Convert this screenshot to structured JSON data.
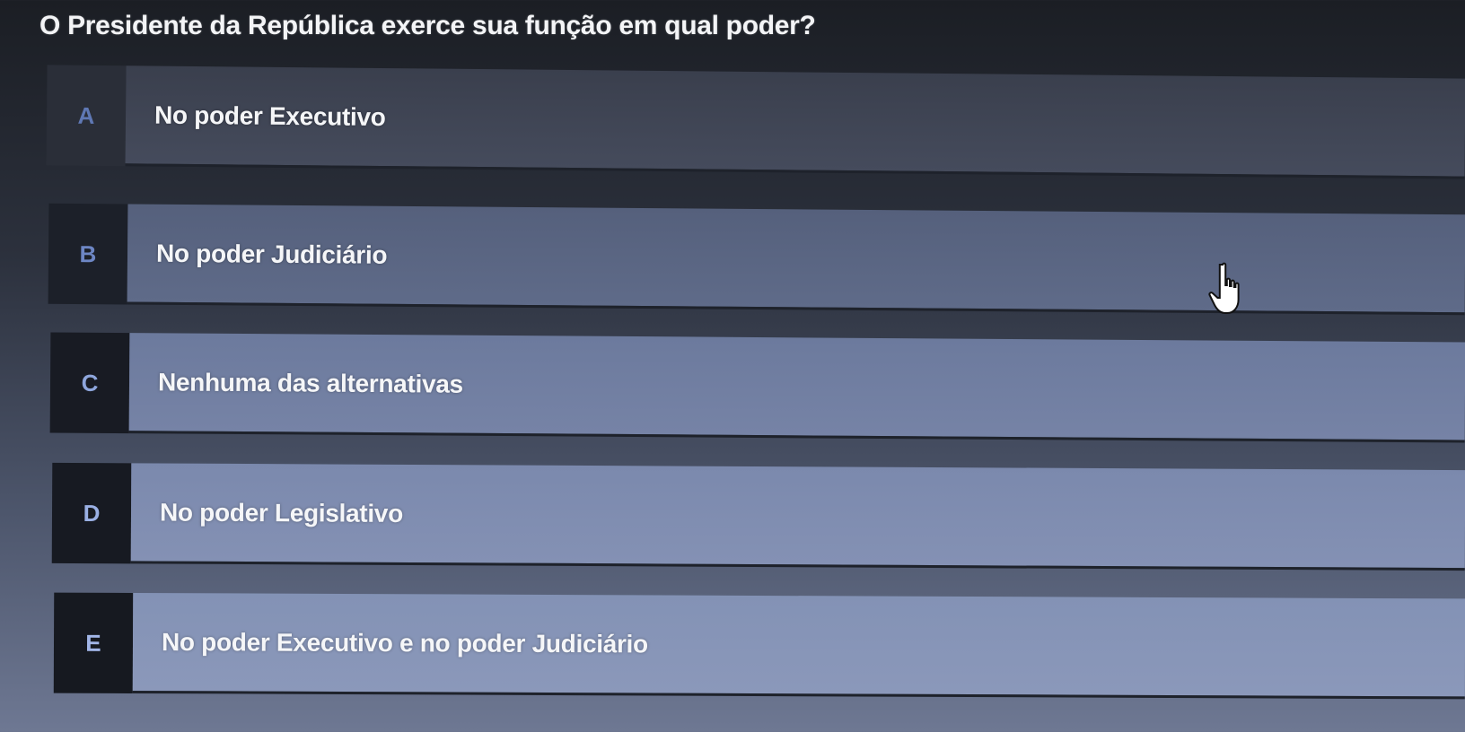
{
  "question": "O Presidente da República exerce sua função em qual poder?",
  "options": [
    {
      "letter": "A",
      "text": "No poder Executivo"
    },
    {
      "letter": "B",
      "text": "No poder Judiciário"
    },
    {
      "letter": "C",
      "text": "Nenhuma das alternativas"
    },
    {
      "letter": "D",
      "text": "No poder Legislativo"
    },
    {
      "letter": "E",
      "text": "No poder Executivo e no poder Judiciário"
    }
  ],
  "cursor": {
    "icon": "hand-pointer-icon"
  }
}
